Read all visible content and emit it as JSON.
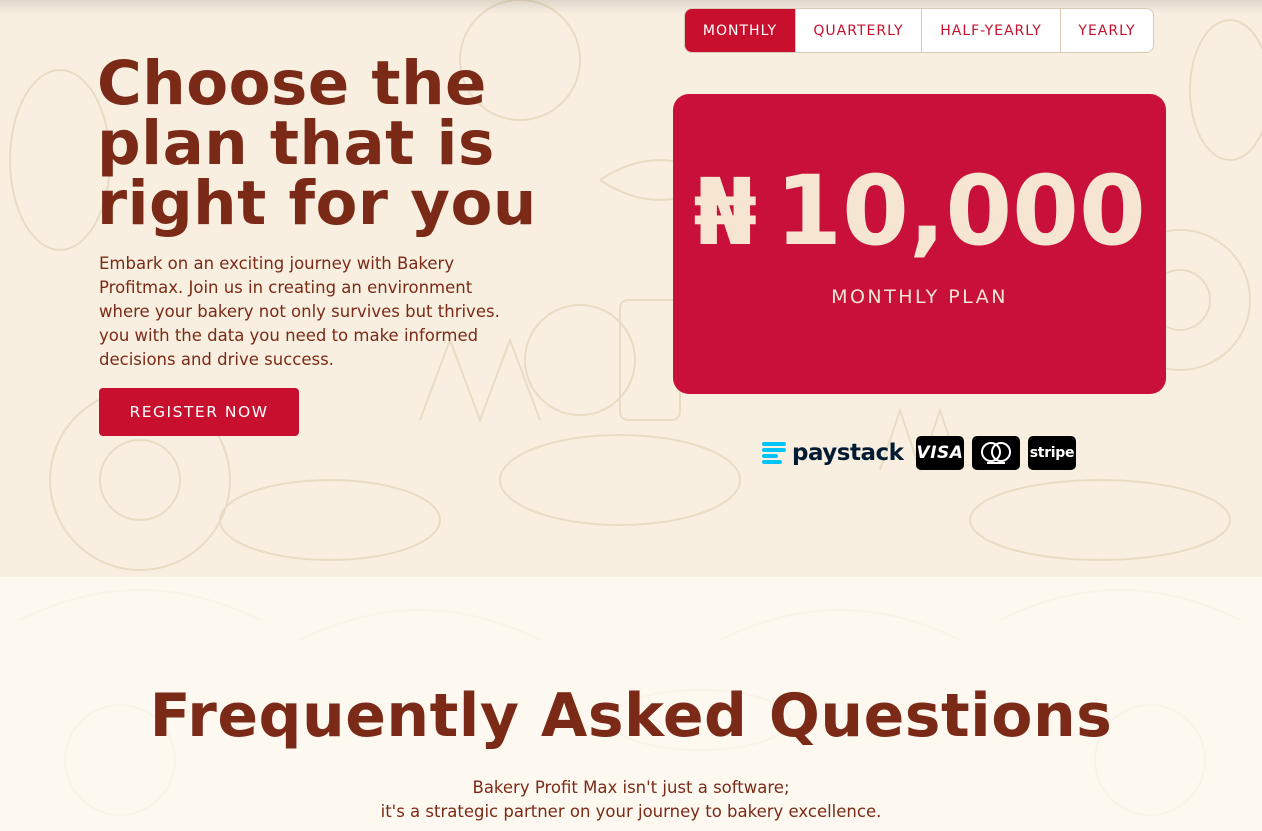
{
  "hero": {
    "title_line1": "Choose the",
    "title_line2": "plan that is",
    "title_line3": "right for you",
    "description": "Embark on an exciting journey with Bakery Profitmax. Join us in creating an environment where your bakery not only survives but thrives. you with the data you need to make informed decisions and drive success.",
    "register_label": "REGISTER NOW"
  },
  "plans": {
    "tabs": [
      {
        "label": "MONTHLY",
        "active": true
      },
      {
        "label": "QUARTERLY",
        "active": false
      },
      {
        "label": "HALF-YEARLY",
        "active": false
      },
      {
        "label": "YEARLY",
        "active": false
      }
    ],
    "price": {
      "currency": "₦",
      "amount": "10,000",
      "plan_label": "MONTHLY PLAN"
    }
  },
  "payment": {
    "paystack": "paystack",
    "visa": "VISA",
    "mastercard_icon": "mastercard-icon",
    "stripe": "stripe"
  },
  "faq": {
    "title": "Frequently Asked Questions",
    "subtitle_line1": "Bakery Profit Max isn't just a software;",
    "subtitle_line2": "it's a strategic partner on your journey to bakery excellence."
  },
  "colors": {
    "brand_red": "#c8102e",
    "card_red": "#c8103a",
    "heading_brown": "#7a2a16",
    "background_cream": "#f8efe1",
    "price_text": "#f6e6d1"
  }
}
